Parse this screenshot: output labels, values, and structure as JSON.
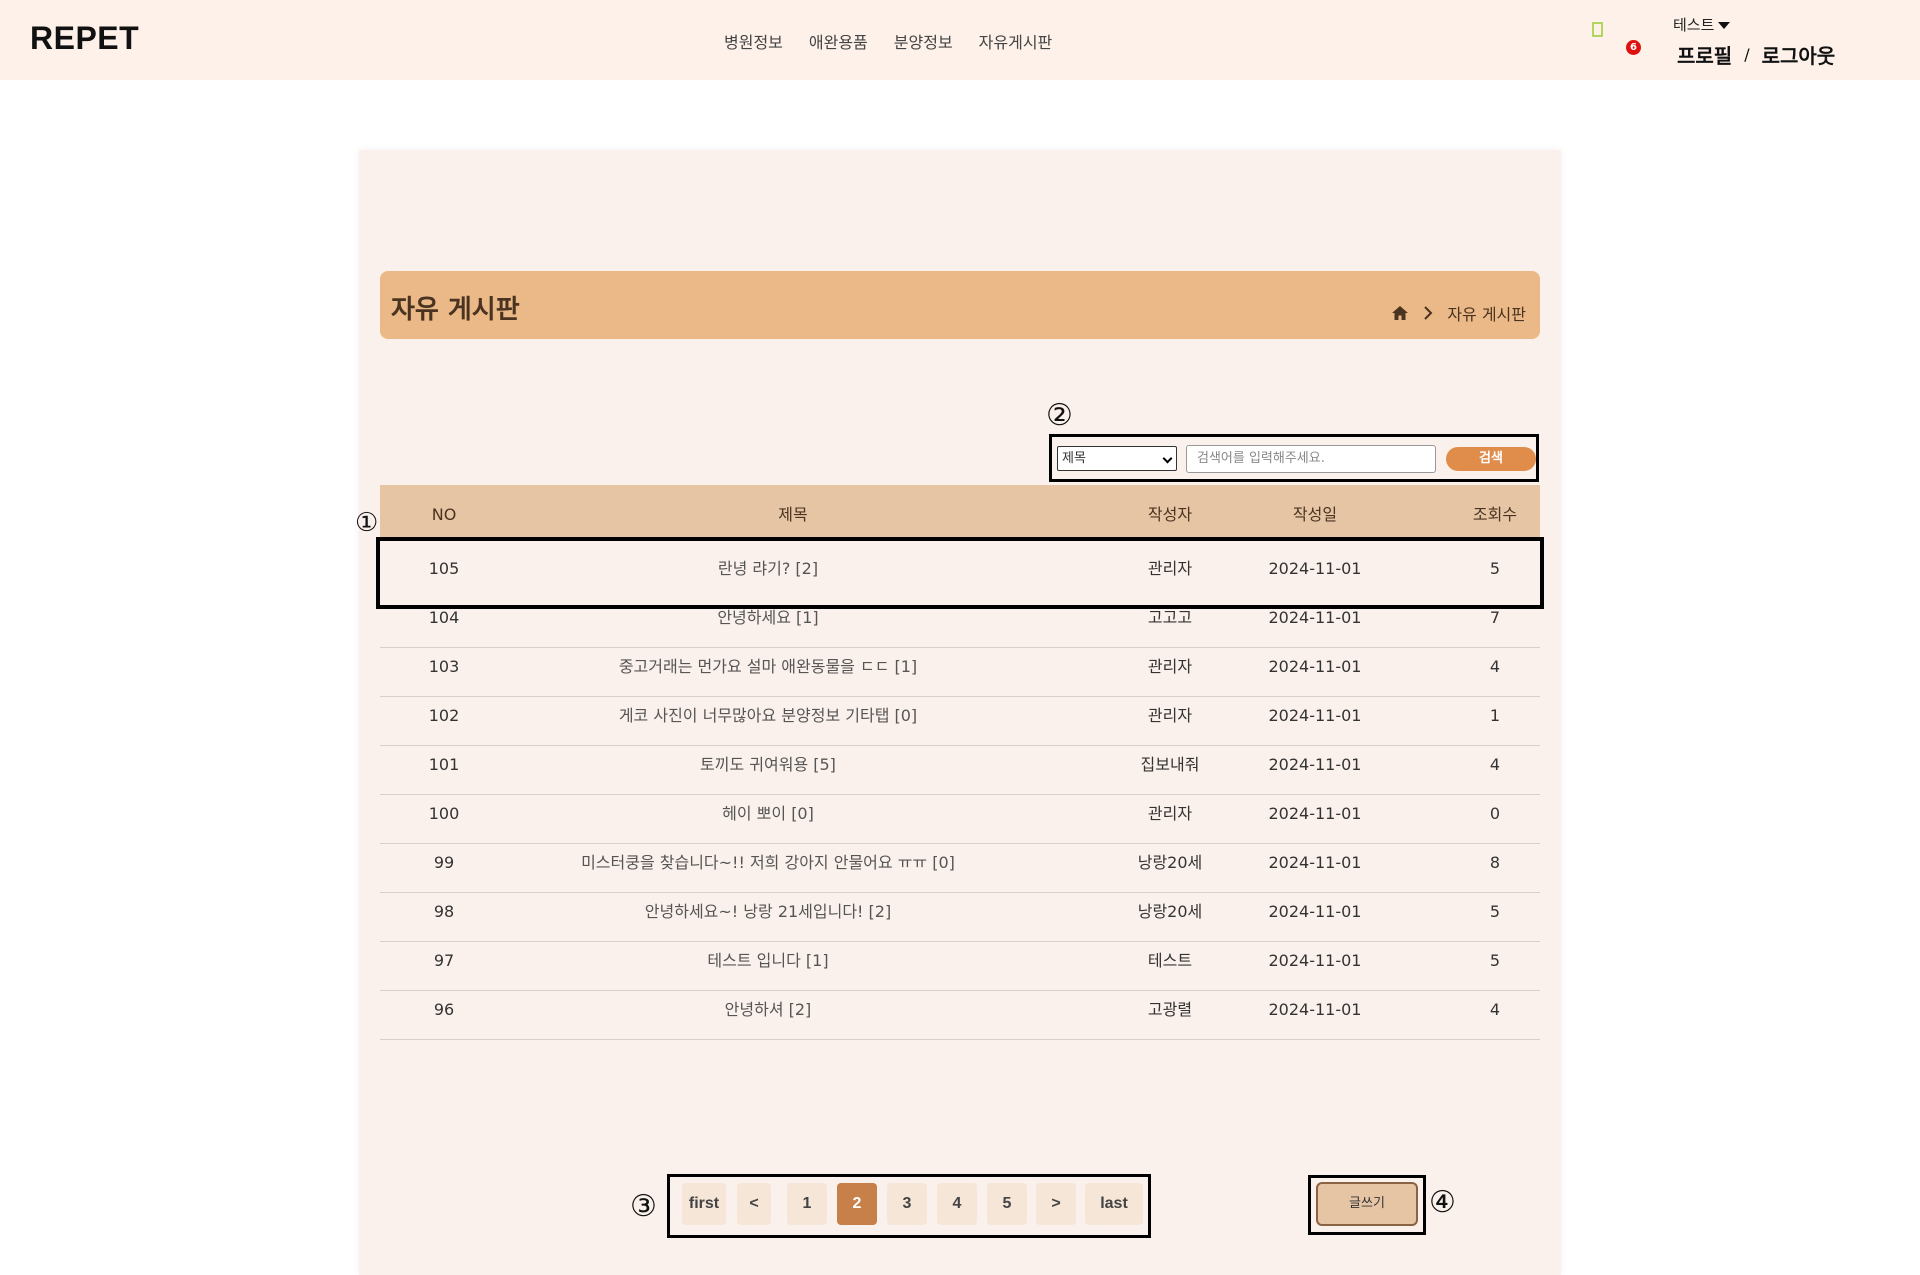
{
  "header": {
    "logo": "REPET",
    "nav": [
      "병원정보",
      "애완용품",
      "분양정보",
      "자유게시판"
    ],
    "cart_count": "6",
    "user_name": "테스트",
    "profile_link": "프로필",
    "separator": "/",
    "logout_link": "로그아웃"
  },
  "board": {
    "title": "자유 게시판",
    "breadcrumb": "자유 게시판"
  },
  "search": {
    "select_value": "제목",
    "placeholder": "검색어를 입력해주세요.",
    "button": "검색"
  },
  "markers": [
    "①",
    "②",
    "③",
    "④"
  ],
  "table": {
    "headers": [
      "NO",
      "제목",
      "작성자",
      "작성일",
      "조회수"
    ],
    "rows": [
      {
        "no": "105",
        "title": "란녕 랴기? [2]",
        "writer": "관리자",
        "date": "2024-11-01",
        "views": "5"
      },
      {
        "no": "104",
        "title": "안녕하세요 [1]",
        "writer": "고고고",
        "date": "2024-11-01",
        "views": "7"
      },
      {
        "no": "103",
        "title": "중고거래는 먼가요 설마 애완동물을 ㄷㄷ [1]",
        "writer": "관리자",
        "date": "2024-11-01",
        "views": "4"
      },
      {
        "no": "102",
        "title": "게코 사진이 너무많아요 분양정보 기타탭 [0]",
        "writer": "관리자",
        "date": "2024-11-01",
        "views": "1"
      },
      {
        "no": "101",
        "title": "토끼도 귀여워용 [5]",
        "writer": "집보내줘",
        "date": "2024-11-01",
        "views": "4"
      },
      {
        "no": "100",
        "title": "헤이 뽀이 [0]",
        "writer": "관리자",
        "date": "2024-11-01",
        "views": "0"
      },
      {
        "no": "99",
        "title": "미스터쿵을 찾습니다~!! 저희 강아지 안물어요 ㅠㅠ [0]",
        "writer": "낭랑20세",
        "date": "2024-11-01",
        "views": "8"
      },
      {
        "no": "98",
        "title": "안녕하세요~! 낭랑 21세입니다! [2]",
        "writer": "낭랑20세",
        "date": "2024-11-01",
        "views": "5"
      },
      {
        "no": "97",
        "title": "테스트 입니다 [1]",
        "writer": "테스트",
        "date": "2024-11-01",
        "views": "5"
      },
      {
        "no": "96",
        "title": "안녕하셔 [2]",
        "writer": "고광렬",
        "date": "2024-11-01",
        "views": "4"
      }
    ]
  },
  "pagination": {
    "items": [
      "first",
      "<",
      "1",
      "2",
      "3",
      "4",
      "5",
      ">",
      "last"
    ],
    "current": "2"
  },
  "write_button": "글쓰기",
  "colors": {
    "header_bg": "#fdf1ea",
    "title_bar": "#ebb987",
    "table_header": "#e6c5a5",
    "search_button": "#e08c4b",
    "active_page": "#c8804a",
    "badge": "#e01010"
  }
}
